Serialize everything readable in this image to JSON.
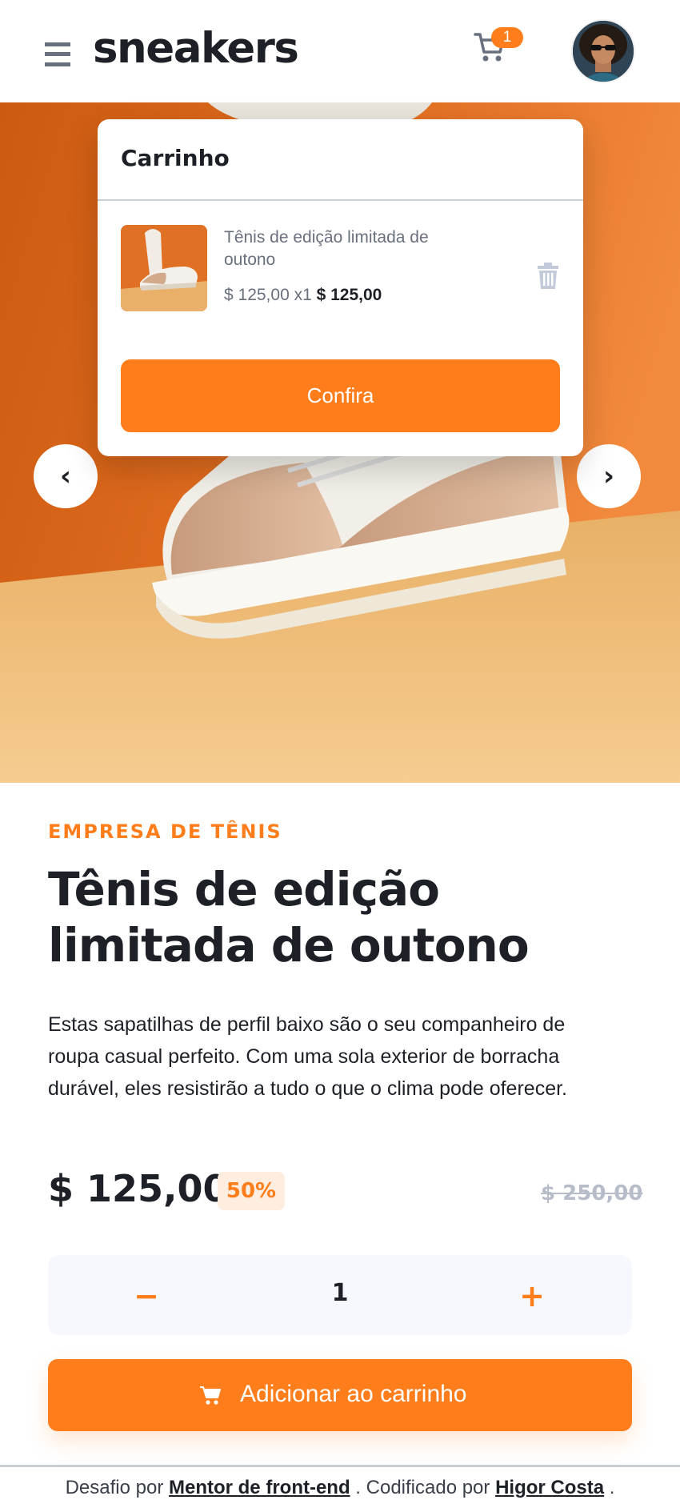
{
  "header": {
    "logo": "sneakers",
    "cart_count": "1"
  },
  "cart": {
    "title": "Carrinho",
    "item": {
      "name": "Tênis de edição limitada de outono",
      "unit_price_qty": "$ 125,00 x1",
      "total": "$ 125,00"
    },
    "checkout_label": "Confira"
  },
  "gallery": {
    "prev_label": "‹",
    "next_label": "›"
  },
  "product": {
    "company": "EMPRESA DE TÊNIS",
    "title": "Tênis de edição limitada de outono",
    "description": "Estas sapatilhas de perfil baixo são o seu companheiro de roupa casual perfeito. Com uma sola exterior de borracha durável, eles resistirão a tudo o que o clima pode oferecer.",
    "price": "$ 125,00",
    "discount": "50%",
    "old_price": "$ 250,00"
  },
  "quantity": {
    "minus": "−",
    "value": "1",
    "plus": "+"
  },
  "add_to_cart": {
    "label": "Adicionar ao carrinho"
  },
  "footer": {
    "prefix": "Desafio por",
    "link1": "Mentor de front-end",
    "middle": ". Codificado por",
    "link2": "Higor Costa",
    "suffix": "."
  },
  "colors": {
    "accent": "#ff7e1b",
    "accent_pale": "#ffede0",
    "dark": "#1d2026",
    "gray": "#69707d",
    "light_gray": "#b6bcc8",
    "qty_bg": "#f6f8fd"
  },
  "icons": [
    "menu-icon",
    "cart-icon",
    "chevron-left-icon",
    "chevron-right-icon",
    "trash-icon"
  ]
}
